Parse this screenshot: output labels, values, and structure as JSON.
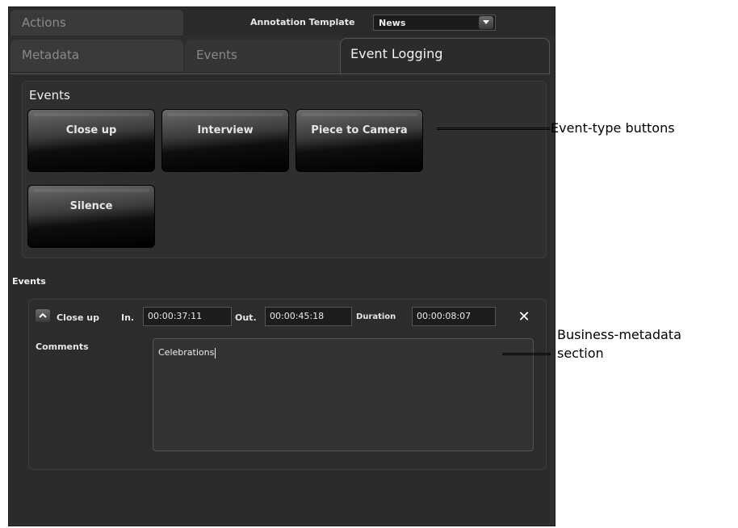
{
  "top": {
    "actions_tab": "Actions",
    "annotation_label": "Annotation Template",
    "template_value": "News"
  },
  "tabs": [
    {
      "label": "Metadata"
    },
    {
      "label": "Events"
    },
    {
      "label": "Event Logging"
    }
  ],
  "events_panel": {
    "title": "Events",
    "buttons": [
      "Close up",
      "Interview",
      "Piece to Camera",
      "Silence"
    ]
  },
  "events_section_label": "Events",
  "event_entry": {
    "name": "Close up",
    "in_label": "In.",
    "in_value": "00:00:37:11",
    "out_label": "Out.",
    "out_value": "00:00:45:18",
    "duration_label": "Duration",
    "duration_value": "00:00:08:07",
    "close_symbol": "✕",
    "comments_label": "Comments",
    "comments_value": "Celebrations"
  },
  "callouts": {
    "event_type": "Event-type buttons",
    "business_line1": "Business-metadata",
    "business_line2": "section"
  }
}
